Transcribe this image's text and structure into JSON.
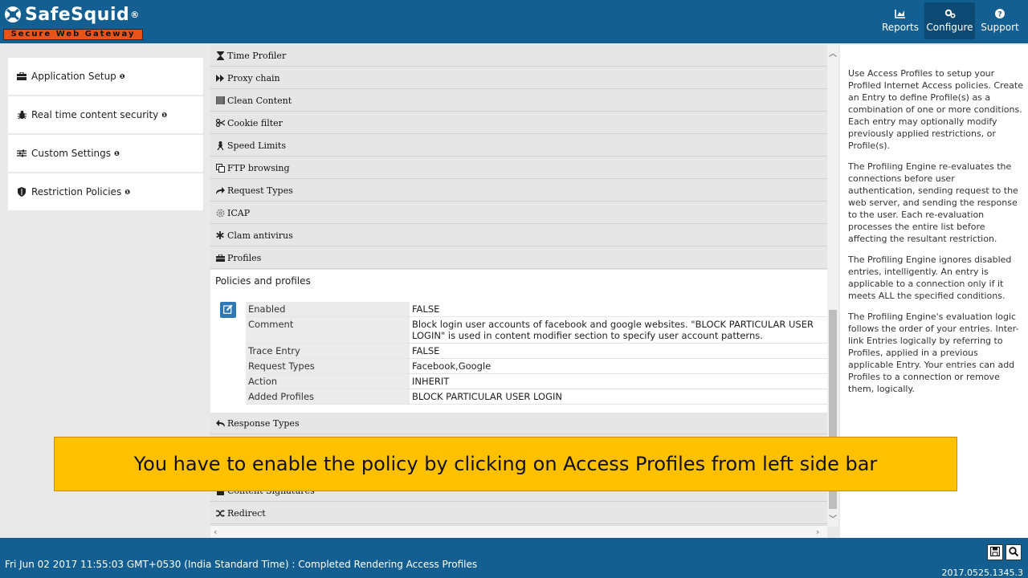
{
  "header": {
    "logo_text": "SafeSquid",
    "logo_reg": "®",
    "logo_tagline": "Secure Web Gateway",
    "nav": [
      {
        "label": "Reports",
        "icon": "chart-icon"
      },
      {
        "label": "Configure",
        "icon": "gears-icon"
      },
      {
        "label": "Support",
        "icon": "question-icon"
      }
    ]
  },
  "sidebar": {
    "items": [
      {
        "label": "Application Setup",
        "icon": "briefcase-icon",
        "info": "❶"
      },
      {
        "label": "Real time content security",
        "icon": "bug-icon",
        "info": "❶"
      },
      {
        "label": "Custom Settings",
        "icon": "sliders-icon",
        "info": "❶"
      },
      {
        "label": "Restriction Policies",
        "icon": "shield-icon",
        "info": "❶"
      }
    ]
  },
  "center": {
    "sections_top": [
      {
        "label": "Time Profiler",
        "icon": "hourglass-icon"
      },
      {
        "label": "Proxy chain",
        "icon": "fast-forward-icon"
      },
      {
        "label": "Clean Content",
        "icon": "filter-icon"
      },
      {
        "label": "Cookie filter",
        "icon": "scissors-icon"
      },
      {
        "label": "Speed Limits",
        "icon": "speed-icon"
      },
      {
        "label": "FTP browsing",
        "icon": "copy-icon"
      },
      {
        "label": "Request Types",
        "icon": "share-icon"
      },
      {
        "label": "ICAP",
        "icon": "cog-icon"
      },
      {
        "label": "Clam antivirus",
        "icon": "asterisk-icon"
      },
      {
        "label": "Profiles",
        "icon": "briefcase-icon"
      }
    ],
    "policy": {
      "title": "Policies and profiles",
      "rows": [
        {
          "key": "Enabled",
          "value": "FALSE"
        },
        {
          "key": "Comment",
          "value": "Block login user accounts of facebook and google websites. \"BLOCK PARTICULAR USER LOGIN\" is used in content modifier section to specify user account patterns."
        },
        {
          "key": "Trace Entry",
          "value": "FALSE"
        },
        {
          "key": "Request Types",
          "value": "Facebook,Google"
        },
        {
          "key": "Action",
          "value": "INHERIT"
        },
        {
          "key": "Added Profiles",
          "value": "BLOCK PARTICULAR USER LOGIN"
        }
      ]
    },
    "sections_bottom": [
      {
        "label": "Response Types",
        "icon": "reply-icon"
      },
      {
        "label": "Content Signatures",
        "icon": "file-icon"
      },
      {
        "label": "Redirect",
        "icon": "shuffle-icon"
      }
    ]
  },
  "help": {
    "paragraphs": [
      "Use Access Profiles to setup your Profiled Internet Access policies. Create an Entry to define Profile(s) as a combination of one or more conditions. Each entry may optionally modify previously applied restrictions, or Profile(s).",
      "The Profiling Engine re-evaluates the connections before user authentication, sending request to the web server, and sending the response to the user. Each re-evaluation processes the entire list before affecting the resultant restriction.",
      "The Profiling Engine ignores disabled entries, intelligently. An entry is applicable to a connection only if it meets ALL the specified conditions.",
      "The Profiling Engine's evaluation logic follows the order of your entries. Inter-link Entries logically by referring to Profiles, applied in a previous applicable Entry. Your entries can add Profiles to a connection or remove them, logically."
    ]
  },
  "banner": {
    "text": "You have to enable the policy by clicking on Access Profiles from left side bar"
  },
  "footer": {
    "status": "Fri Jun 02 2017 11:55:03 GMT+0530 (India Standard Time) : Completed Rendering Access Profiles",
    "version": "2017.0525.1345.3"
  },
  "colors": {
    "header_bg": "#145f92",
    "logo_tag_bg": "#e8531c",
    "banner_bg": "#ffc000",
    "edit_button": "#2e78b5"
  }
}
